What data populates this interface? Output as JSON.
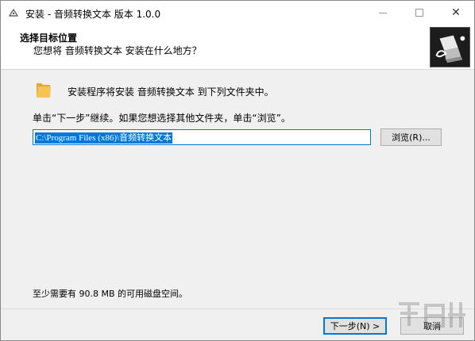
{
  "window": {
    "title": "安装 - 音频转换文本 版本 1.0.0",
    "close_glyph": "✕"
  },
  "header": {
    "title": "选择目标位置",
    "subtitle": "您想将 音频转换文本 安装在什么地方？"
  },
  "body": {
    "install_message": "安装程序将安装 音频转换文本 到下列文件夹中。",
    "click_message": "单击“下一步”继续。如果您想选择其他文件夹，单击“浏览”。",
    "path_value": "C:\\Program Files (x86)\\音频转换文本",
    "browse_label": "浏览(R)...",
    "space_message": "至少需要有 90.8 MB 的可用磁盘空间。"
  },
  "footer": {
    "next_label": "下一步(N) >",
    "cancel_label": "取消"
  },
  "colors": {
    "accent": "#0078d7",
    "dialog_bg": "#f0f0f0",
    "button_bg": "#e1e1e1",
    "folder": "#f5c453"
  }
}
